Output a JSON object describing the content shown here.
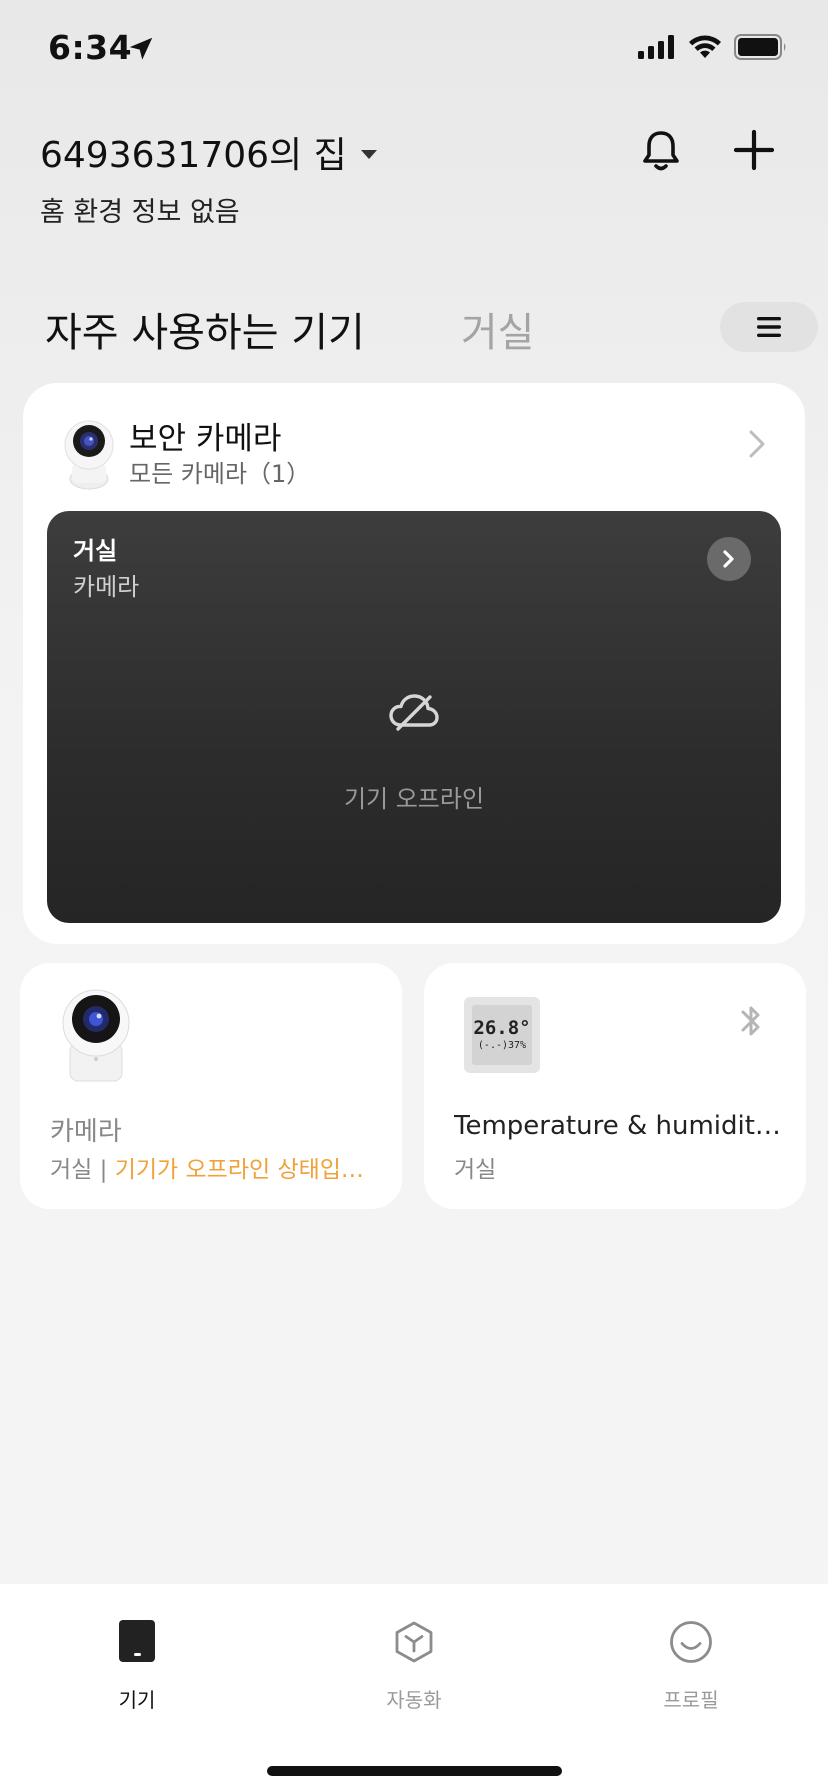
{
  "status_bar": {
    "time": "6:34"
  },
  "header": {
    "home_name": "6493631706의 집",
    "home_subtitle": "홈 환경 정보 없음",
    "icons": [
      "bell-icon",
      "plus-icon"
    ]
  },
  "tabs": [
    {
      "label": "자주 사용하는 기기",
      "active": true
    },
    {
      "label": "거실",
      "active": false
    }
  ],
  "security_card": {
    "title": "보안 카메라",
    "subtitle": "모든 카메라（1）",
    "preview": {
      "room": "거실",
      "device_type": "카메라",
      "status": "기기 오프라인"
    }
  },
  "devices": [
    {
      "name": "카메라",
      "room": "거실",
      "separator": " | ",
      "status": "기기가 오프라인 상태입…",
      "status_color": "#f0a23a"
    },
    {
      "name": "Temperature & humidit…",
      "room": "거실",
      "display_line1": "26.8°",
      "display_line2": "(-.-)37%"
    }
  ],
  "tab_bar": [
    {
      "label": "기기",
      "icon": "device-icon",
      "active": true
    },
    {
      "label": "자동화",
      "icon": "automation-icon",
      "active": false
    },
    {
      "label": "프로필",
      "icon": "profile-icon",
      "active": false
    }
  ],
  "colors": {
    "accent_warning": "#f0a23a",
    "active_tab": "#111111",
    "inactive_tab": "#9a9a9a"
  }
}
